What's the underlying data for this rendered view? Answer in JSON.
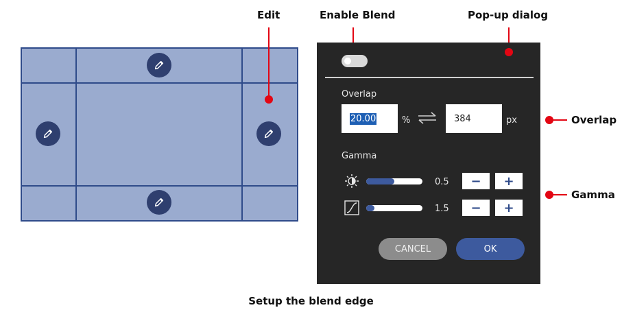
{
  "annotations": {
    "edit": "Edit",
    "enable_blend": "Enable Blend",
    "popup_dialog": "Pop-up dialog",
    "overlap": "Overlap",
    "gamma": "Gamma"
  },
  "dialog": {
    "blend_toggle": {
      "state": "off"
    },
    "overlap": {
      "label": "Overlap",
      "percent_value": "20.00",
      "percent_unit": "%",
      "swap_icon": "swap-arrows-icon",
      "px_value": "384",
      "px_unit": "px"
    },
    "gamma": {
      "label": "Gamma",
      "rows": [
        {
          "icon": "brightness-icon",
          "value": "0.5",
          "slider_level": 0.5,
          "minus": "−",
          "plus": "+"
        },
        {
          "icon": "gamma-curve-icon",
          "value": "1.5",
          "slider_level": 0.15,
          "minus": "−",
          "plus": "+"
        }
      ]
    },
    "cancel_label": "CANCEL",
    "ok_label": "OK"
  },
  "caption": "Setup the blend edge",
  "colors": {
    "grid_fill": "#9aabcf",
    "grid_line": "#2f4b8a",
    "edit_button": "#2f3f6f",
    "dialog_bg": "#262626",
    "accent": "#3d5a9e",
    "annotation_red": "#e30613"
  }
}
